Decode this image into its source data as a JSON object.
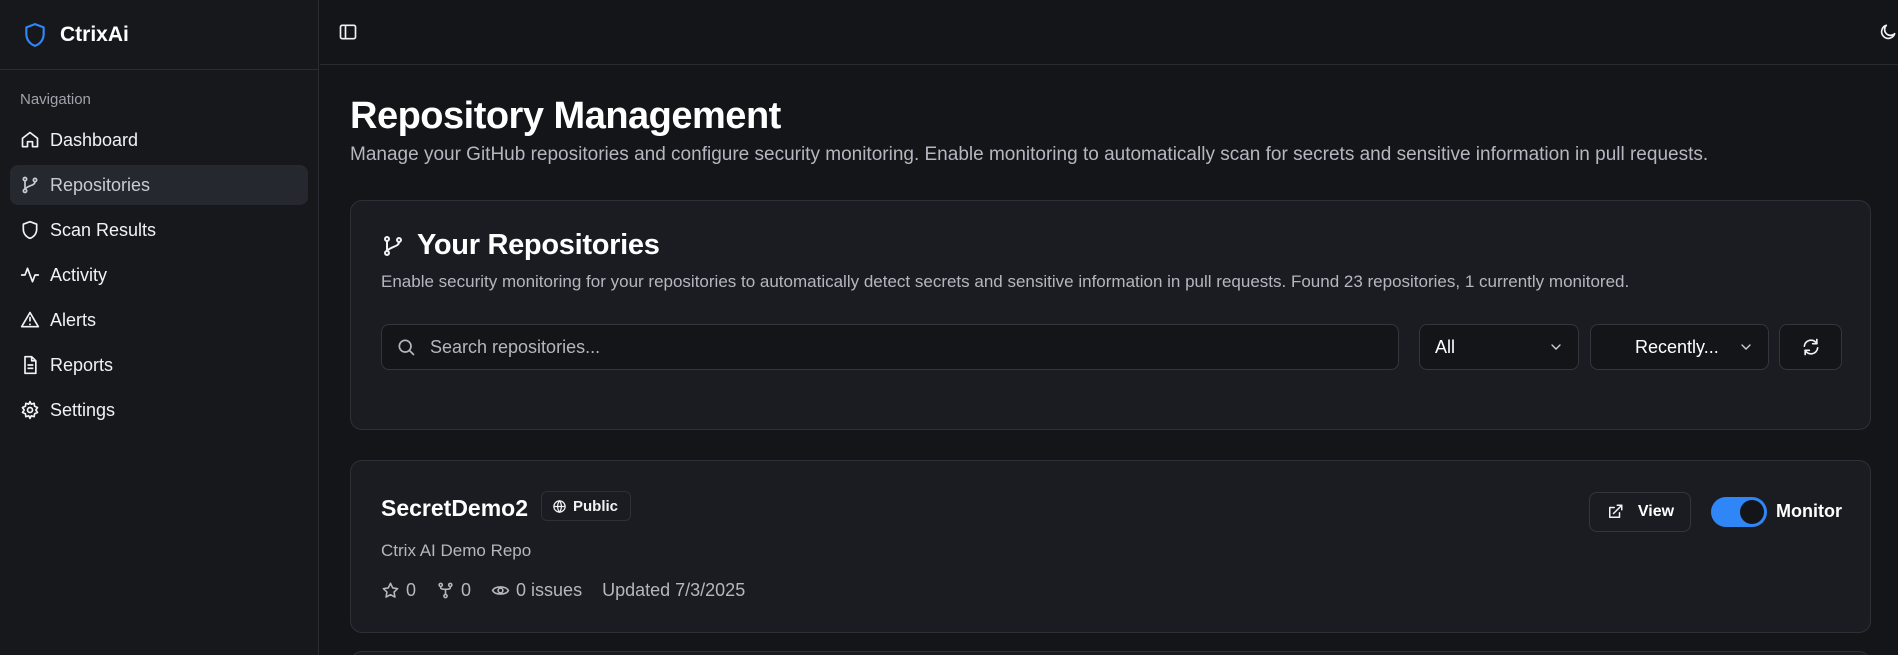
{
  "app": {
    "name": "CtrixAi"
  },
  "colors": {
    "accent": "#2f86f6",
    "background": "#141519",
    "card": "#1b1c21"
  },
  "sidebar": {
    "section_title": "Navigation",
    "items": [
      {
        "label": "Dashboard",
        "icon": "home-icon"
      },
      {
        "label": "Repositories",
        "icon": "git-branch-icon",
        "active": true
      },
      {
        "label": "Scan Results",
        "icon": "shield-icon"
      },
      {
        "label": "Activity",
        "icon": "activity-icon"
      },
      {
        "label": "Alerts",
        "icon": "alert-triangle-icon"
      },
      {
        "label": "Reports",
        "icon": "file-text-icon"
      },
      {
        "label": "Settings",
        "icon": "gear-icon"
      }
    ]
  },
  "page": {
    "title": "Repository Management",
    "subtitle": "Manage your GitHub repositories and configure security monitoring. Enable monitoring to automatically scan for secrets and sensitive information in pull requests."
  },
  "repos_card": {
    "title": "Your Repositories",
    "description": "Enable security monitoring for your repositories to automatically detect secrets and sensitive information in pull requests. Found 23 repositories, 1 currently monitored.",
    "search_placeholder": "Search repositories...",
    "filter_value": "All",
    "sort_value": "Recently..."
  },
  "repositories": [
    {
      "name": "SecretDemo2",
      "visibility": "Public",
      "description": "Ctrix AI Demo Repo",
      "stars": "0",
      "forks": "0",
      "issues": "0 issues",
      "updated": "Updated 7/3/2025",
      "view_label": "View",
      "monitor_label": "Monitor",
      "monitored": true
    }
  ]
}
